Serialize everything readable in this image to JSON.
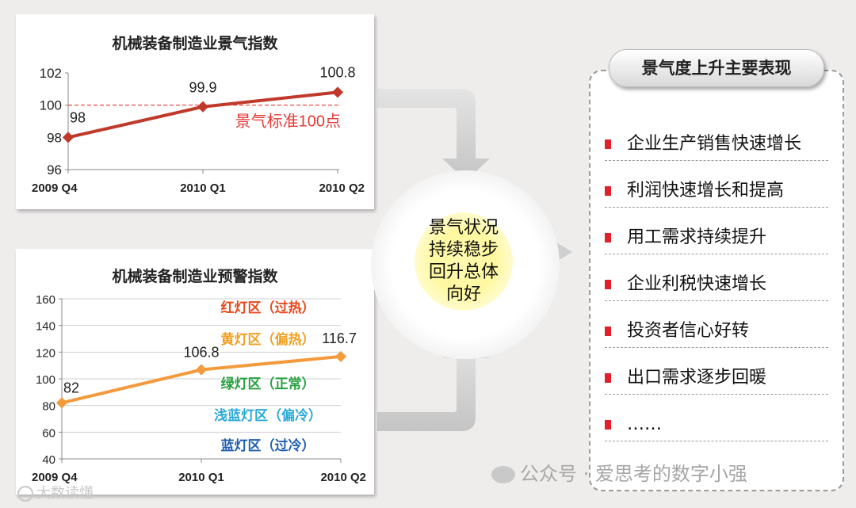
{
  "chart_data": [
    {
      "type": "line",
      "title": "机械装备制造业景气指数",
      "categories": [
        "2009 Q4",
        "2010 Q1",
        "2010 Q2"
      ],
      "series": [
        {
          "values": [
            98,
            99.9,
            100.8
          ],
          "color": "#c0392b"
        }
      ],
      "data_labels": [
        "98",
        "99.9",
        "100.8"
      ],
      "ylim": [
        96,
        102
      ],
      "yticks": [
        "96",
        "98",
        "100",
        "102"
      ],
      "reference_line": {
        "value": 100,
        "label": "景气标准100点",
        "color": "#e53935"
      },
      "grid": false
    },
    {
      "type": "line",
      "title": "机械装备制造业预警指数",
      "categories": [
        "2009 Q4",
        "2010 Q1",
        "2010 Q2"
      ],
      "series": [
        {
          "values": [
            82,
            106.8,
            116.7
          ],
          "color": "#f39a3d"
        }
      ],
      "data_labels": [
        "82",
        "106.8",
        "116.7"
      ],
      "ylim": [
        40,
        160
      ],
      "yticks": [
        "40",
        "60",
        "80",
        "100",
        "120",
        "140",
        "160"
      ],
      "grid": true,
      "zones": [
        {
          "label": "红灯区（过热）",
          "color": "#e8481c"
        },
        {
          "label": "黄灯区（偏热）",
          "color": "#f0a020"
        },
        {
          "label": "绿灯区（正常）",
          "color": "#27a040"
        },
        {
          "label": "浅蓝灯区（偏冷）",
          "color": "#29a9d8"
        },
        {
          "label": "蓝灯区（过冷）",
          "color": "#1f5fb0"
        }
      ]
    }
  ],
  "center": {
    "text": "景气状况持续稳步回升总体向好"
  },
  "right_panel": {
    "title": "景气度上升主要表现",
    "items": [
      "企业生产销售快速增长",
      "利润快速增长和提高",
      "用工需求持续提升",
      "企业利税快速增长",
      "投资者信心好转",
      "出口需求逐步回暖",
      "……"
    ],
    "bullet_color": "#e0202a"
  },
  "watermark": {
    "text": "公众号 · 爱思考的数字小强"
  },
  "logo_text": "大数读懂"
}
